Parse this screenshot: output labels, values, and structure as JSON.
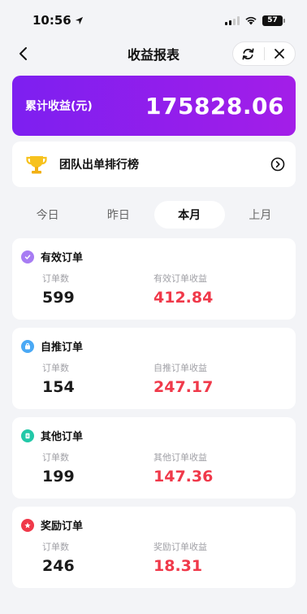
{
  "status_bar": {
    "time": "10:56",
    "battery": "57"
  },
  "nav": {
    "title": "收益报表"
  },
  "total": {
    "label": "累计收益(元)",
    "value": "175828.06"
  },
  "ranking": {
    "title": "团队出单排行榜"
  },
  "tabs": [
    {
      "label": "今日",
      "active": false
    },
    {
      "label": "昨日",
      "active": false
    },
    {
      "label": "本月",
      "active": true
    },
    {
      "label": "上月",
      "active": false
    }
  ],
  "orders": [
    {
      "title": "有效订单",
      "count_label": "订单数",
      "count": "599",
      "income_label": "有效订单收益",
      "income": "412.84",
      "icon": "check-badge-icon",
      "color": "#a77cf3"
    },
    {
      "title": "自推订单",
      "count_label": "订单数",
      "count": "154",
      "income_label": "自推订单收益",
      "income": "247.17",
      "icon": "bag-icon",
      "color": "#4aa9f5"
    },
    {
      "title": "其他订单",
      "count_label": "订单数",
      "count": "199",
      "income_label": "其他订单收益",
      "income": "147.36",
      "icon": "document-icon",
      "color": "#22c8a8"
    },
    {
      "title": "奖励订单",
      "count_label": "订单数",
      "count": "246",
      "income_label": "奖励订单收益",
      "income": "18.31",
      "icon": "star-icon",
      "color": "#f0394a"
    }
  ],
  "colors": {
    "accent_start": "#7d1ff0",
    "accent_end": "#a31ee8",
    "income_red": "#f0394a",
    "background": "#f3f4f7"
  }
}
